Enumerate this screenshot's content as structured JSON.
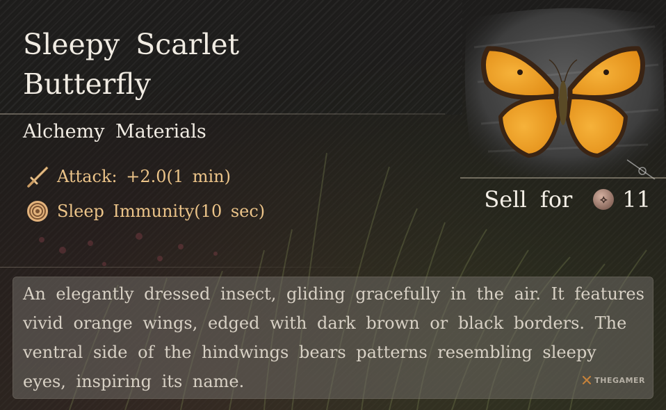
{
  "item": {
    "name": "Sleepy Scarlet Butterfly",
    "category": "Alchemy Materials",
    "effects": [
      {
        "icon": "sword-icon",
        "text": "Attack: +2.0(1 min)"
      },
      {
        "icon": "sleep-swirl-icon",
        "text": "Sleep Immunity(10 sec)"
      }
    ],
    "sell": {
      "label": "Sell for",
      "coin_icon": "currency-coin-icon",
      "price": "11"
    },
    "description": "An elegantly dressed insect, gliding gracefully in the air. It features vivid orange wings, edged with dark brown or black borders. The ventral side of the hindwings bears patterns resembling sleepy eyes, inspiring its name."
  },
  "watermark": "THEGAMER",
  "colors": {
    "title_text": "#f1ece3",
    "effect_text": "#ecc489",
    "description_text": "#d8d1c5",
    "wing_orange": "#f0a21c"
  }
}
